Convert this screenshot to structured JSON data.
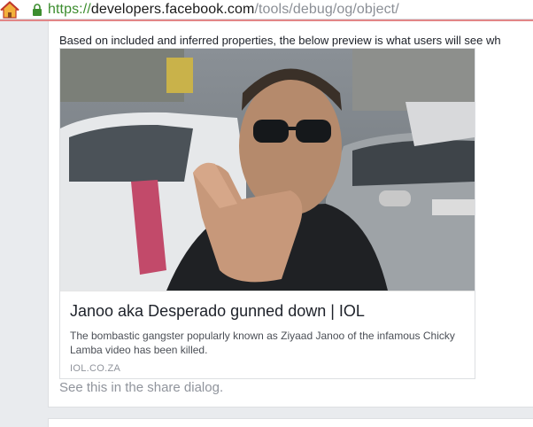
{
  "browser": {
    "url_scheme": "https://",
    "url_host": "developers.facebook.com",
    "url_path": "/tools/debug/og/object/"
  },
  "content": {
    "intro_text": "Based on included and inferred properties, the below preview is what users will see wh",
    "preview": {
      "title": "Janoo aka Desperado gunned down | IOL",
      "description": "The bombastic gangster popularly known as Ziyaad Janoo of the infamous Chicky Lamba video has been killed.",
      "domain": "IOL.CO.ZA",
      "image_icon": "photo-of-man-pointing-finger"
    },
    "share_link": "See this in the share dialog."
  },
  "colors": {
    "scheme_green": "#3c8d2f",
    "page_background": "#e9ebee",
    "link_gray": "#90949c"
  }
}
